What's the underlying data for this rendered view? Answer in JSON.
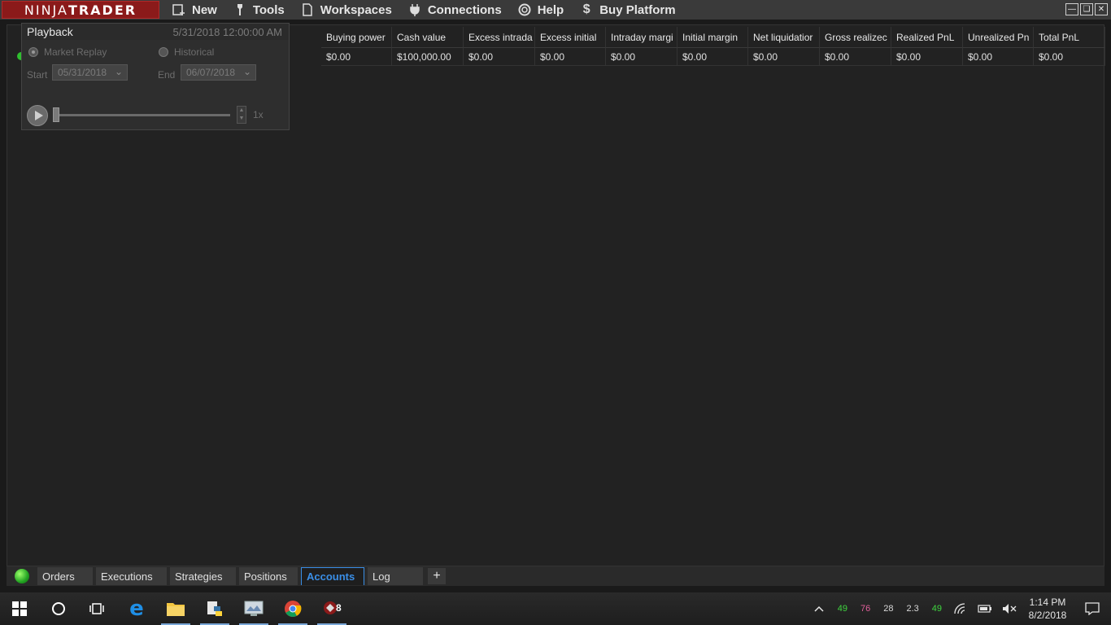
{
  "app": {
    "logo_prefix": "NINJA",
    "logo_suffix": "TRADER",
    "menu": [
      {
        "label": "New",
        "icon": "new-window-icon"
      },
      {
        "label": "Tools",
        "icon": "wrench-icon"
      },
      {
        "label": "Workspaces",
        "icon": "document-icon"
      },
      {
        "label": "Connections",
        "icon": "plug-icon"
      },
      {
        "label": "Help",
        "icon": "lifebuoy-icon"
      },
      {
        "label": "Buy Platform",
        "icon": "dollar-icon"
      }
    ],
    "window_controls": [
      "minimize",
      "restore",
      "close"
    ]
  },
  "playback": {
    "title": "Playback",
    "datetime": "5/31/2018 12:00:00 AM",
    "mode_market_replay": "Market Replay",
    "mode_historical": "Historical",
    "start_label": "Start",
    "start_value": "05/31/2018",
    "end_label": "End",
    "end_value": "06/07/2018",
    "speed": "1x"
  },
  "grid": {
    "columns": [
      "Buying power",
      "Cash value",
      "Excess intrada",
      "Excess initial",
      "Intraday margi",
      "Initial margin",
      "Net liquidatior",
      "Gross realizec",
      "Realized PnL",
      "Unrealized Pn",
      "Total PnL"
    ],
    "rows": [
      [
        "$0.00",
        "$100,000.00",
        "$0.00",
        "$0.00",
        "$0.00",
        "$0.00",
        "$0.00",
        "$0.00",
        "$0.00",
        "$0.00",
        "$0.00"
      ]
    ]
  },
  "tabs": {
    "items": [
      "Orders",
      "Executions",
      "Strategies",
      "Positions",
      "Accounts",
      "Log"
    ],
    "active": "Accounts",
    "add_label": "+"
  },
  "taskbar": {
    "apps": [
      "windows-start-icon",
      "search-circle-icon",
      "task-view-icon",
      "edge-browser-icon",
      "file-explorer-icon",
      "python-icon",
      "monitor-app-icon",
      "chrome-icon",
      "ninjatrader-icon"
    ],
    "ninja_badge": "8",
    "tray_stats": [
      {
        "value": "49",
        "color": "#3fd63f"
      },
      {
        "value": "76",
        "color": "#e0609a"
      },
      {
        "value": "28",
        "color": "#d8d8d8"
      },
      {
        "value": "2.3",
        "color": "#d8d8d8"
      },
      {
        "value": "49",
        "color": "#3fd63f"
      }
    ],
    "time": "1:14 PM",
    "date": "8/2/2018"
  }
}
